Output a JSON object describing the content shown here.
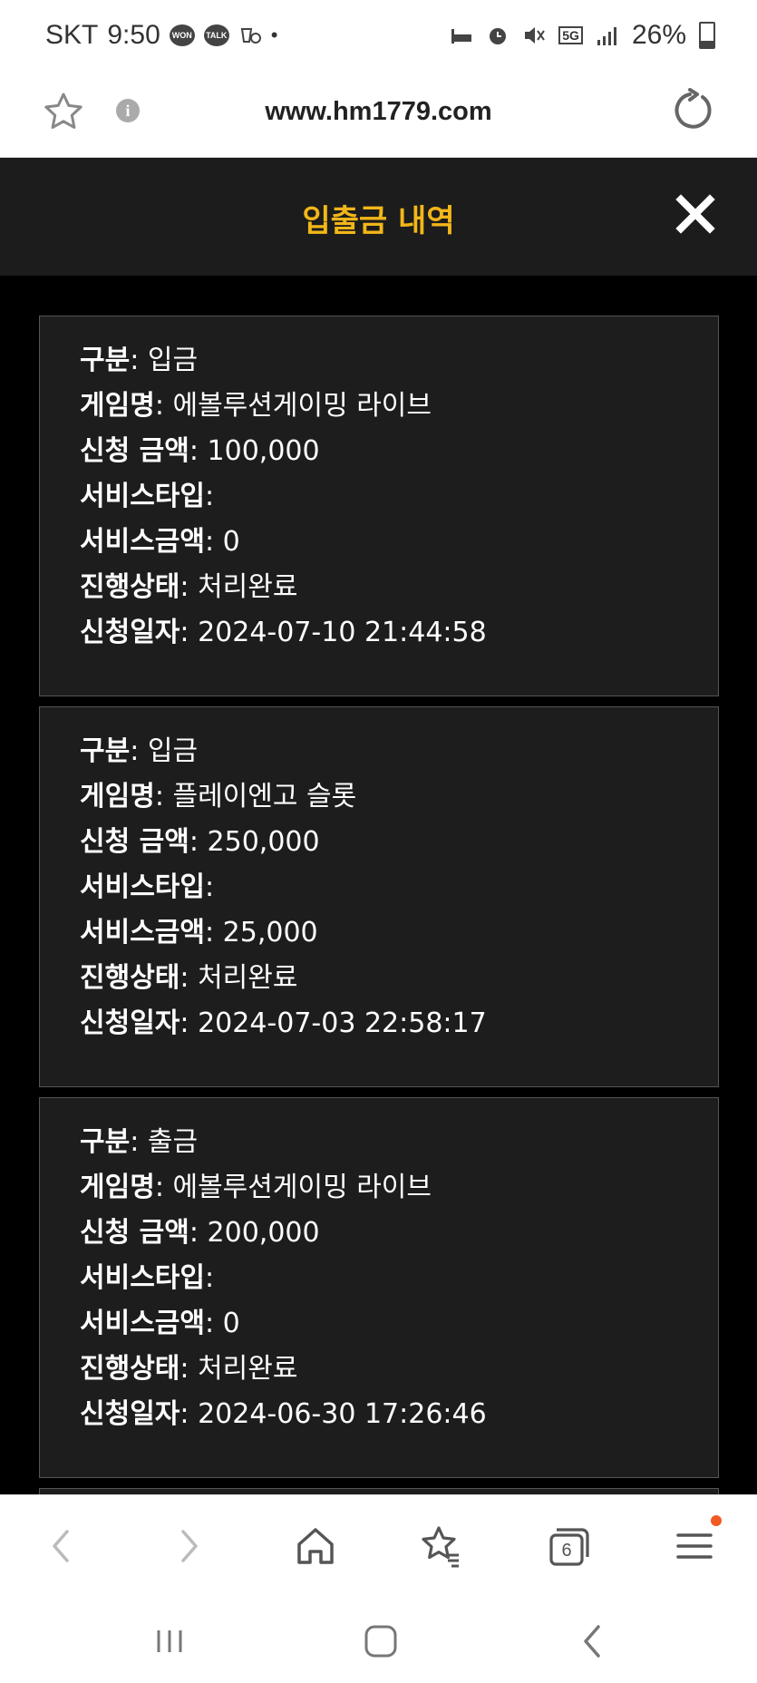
{
  "status_bar": {
    "carrier": "SKT",
    "time": "9:50",
    "network": "5G",
    "battery": "26%",
    "badges": [
      "WON",
      "TALK"
    ]
  },
  "browser": {
    "url": "www.hm1779.com"
  },
  "modal": {
    "title": "입출금 내역",
    "labels": {
      "type": "구분",
      "game": "게임명",
      "amount": "신청 금액",
      "service_type": "서비스타입",
      "service_amount": "서비스금액",
      "status": "진행상태",
      "date": "신청일자"
    },
    "records": [
      {
        "type": "입금",
        "game": "에볼루션게이밍 라이브",
        "amount": "100,000",
        "service_type": "",
        "service_amount": "0",
        "status": "처리완료",
        "date": "2024-07-10 21:44:58"
      },
      {
        "type": "입금",
        "game": "플레이엔고 슬롯",
        "amount": "250,000",
        "service_type": "",
        "service_amount": "25,000",
        "status": "처리완료",
        "date": "2024-07-03 22:58:17"
      },
      {
        "type": "출금",
        "game": "에볼루션게이밍 라이브",
        "amount": "200,000",
        "service_type": "",
        "service_amount": "0",
        "status": "처리완료",
        "date": "2024-06-30 17:26:46"
      }
    ]
  },
  "toolbar": {
    "tab_count": "6"
  },
  "colors": {
    "title_accent": "#f2b619",
    "notification_dot": "#f15a24",
    "card_bg": "#1d1d1d",
    "page_bg": "#000000"
  }
}
